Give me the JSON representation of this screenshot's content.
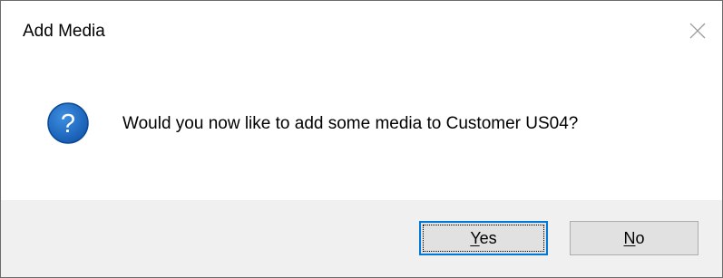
{
  "dialog": {
    "title": "Add Media",
    "message": "Would you now like to add some media to Customer US04?",
    "icon": "question-icon"
  },
  "buttons": {
    "yes": {
      "mnemonic": "Y",
      "rest": "es"
    },
    "no": {
      "mnemonic": "N",
      "rest": "o"
    }
  },
  "colors": {
    "icon_blue": "#1e6fc8",
    "button_bar": "#f0f0f0",
    "focus_border": "#0078d7"
  }
}
